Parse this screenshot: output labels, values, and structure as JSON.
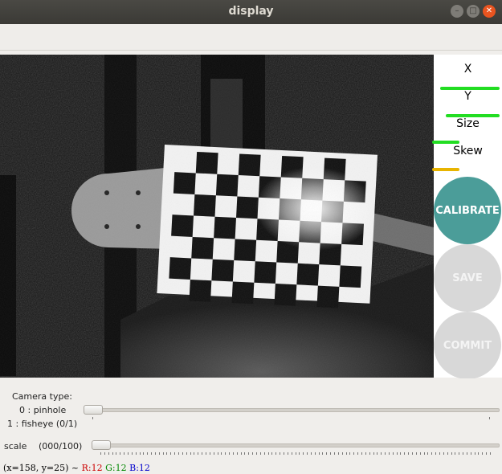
{
  "window": {
    "title": "display"
  },
  "sidepanel": {
    "metrics": [
      {
        "label": "X",
        "color": "#22dd22",
        "level": 0.93
      },
      {
        "label": "Y",
        "color": "#22dd22",
        "level": 0.84
      },
      {
        "label": "Size",
        "color": "#22dd22",
        "level": 0.42
      },
      {
        "label": "Skew",
        "color": "#e8b400",
        "level": 0.42
      }
    ],
    "buttons": [
      {
        "label": "CALIBRATE",
        "bg": "#4b9d99",
        "fg": "#ffffff"
      },
      {
        "label": "SAVE",
        "bg": "#d8d8d8",
        "fg": "#f4f4f4"
      },
      {
        "label": "COMMIT",
        "bg": "#d8d8d8",
        "fg": "#f4f4f4"
      }
    ]
  },
  "controls": {
    "camera_type_label": "Camera type:",
    "option_pinhole": "0 : pinhole",
    "option_fisheye": "1 : fisheye (0/1)",
    "camera_type_value": 0,
    "scale_label": "scale",
    "scale_value_text": "(000/100)",
    "scale_value": 0
  },
  "status": {
    "coords": "(x=158, y=25) ~ ",
    "r": "R:12",
    "g": "G:12",
    "b": "B:12",
    "r_color": "#cc0000",
    "g_color": "#008800",
    "b_color": "#0000cc"
  }
}
